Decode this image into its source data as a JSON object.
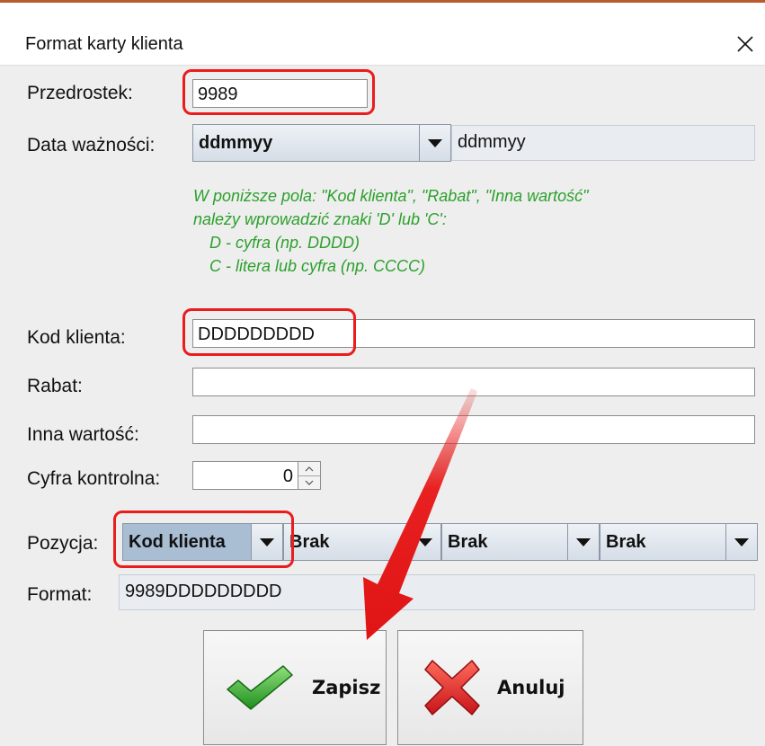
{
  "window": {
    "title": "Format karty klienta",
    "close_glyph": "✕"
  },
  "form": {
    "prefix": {
      "label": "Przedrostek:",
      "value": "9989"
    },
    "date": {
      "label": "Data ważności:",
      "selected": "ddmmyy",
      "preview": "ddmmyy"
    },
    "note_lines": [
      "W poniższe pola: \"Kod klienta\", \"Rabat\", \"Inna wartość\"",
      "należy wprowadzić znaki 'D' lub 'C':",
      "D - cyfra (np. DDDD)",
      "C - litera lub cyfra (np. CCCC)"
    ],
    "client_code": {
      "label": "Kod klienta:",
      "value": "DDDDDDDDD"
    },
    "discount": {
      "label": "Rabat:",
      "value": ""
    },
    "other": {
      "label": "Inna wartość:",
      "value": ""
    },
    "check_digit": {
      "label": "Cyfra kontrolna:",
      "value": "0"
    },
    "position": {
      "label": "Pozycja:",
      "combos": [
        "Kod klienta",
        "Brak",
        "Brak",
        "Brak"
      ]
    },
    "format": {
      "label": "Format:",
      "value": "9989DDDDDDDDD"
    }
  },
  "buttons": {
    "save": "Zapisz",
    "cancel": "Anuluj"
  },
  "colors": {
    "note_green": "#2ca02c",
    "highlight_red": "#ea1c1c",
    "accent_strip": "#b85c2e"
  }
}
